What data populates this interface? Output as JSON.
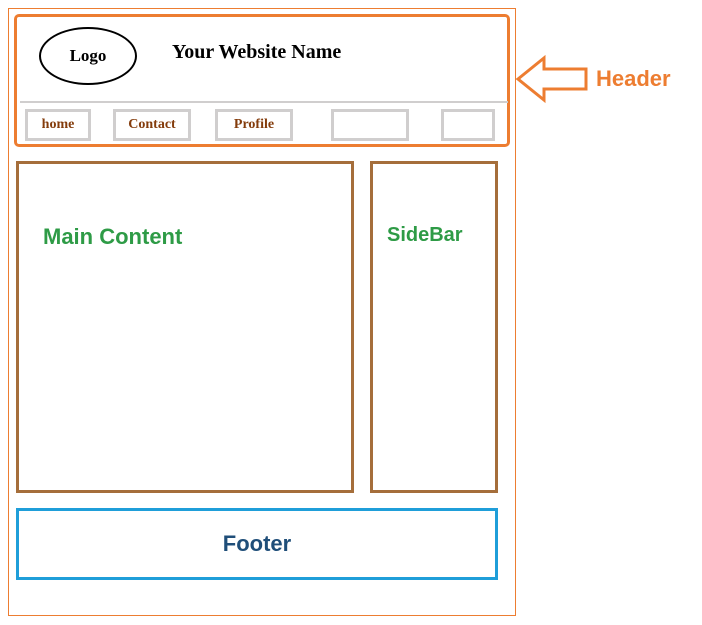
{
  "header": {
    "logo_label": "Logo",
    "site_title": "Your Website Name",
    "nav": [
      "home",
      "Contact",
      "Profile",
      "",
      ""
    ]
  },
  "main": {
    "label": "Main Content"
  },
  "sidebar": {
    "label": "SideBar"
  },
  "footer": {
    "label": "Footer"
  },
  "callout": {
    "label": "Header"
  }
}
